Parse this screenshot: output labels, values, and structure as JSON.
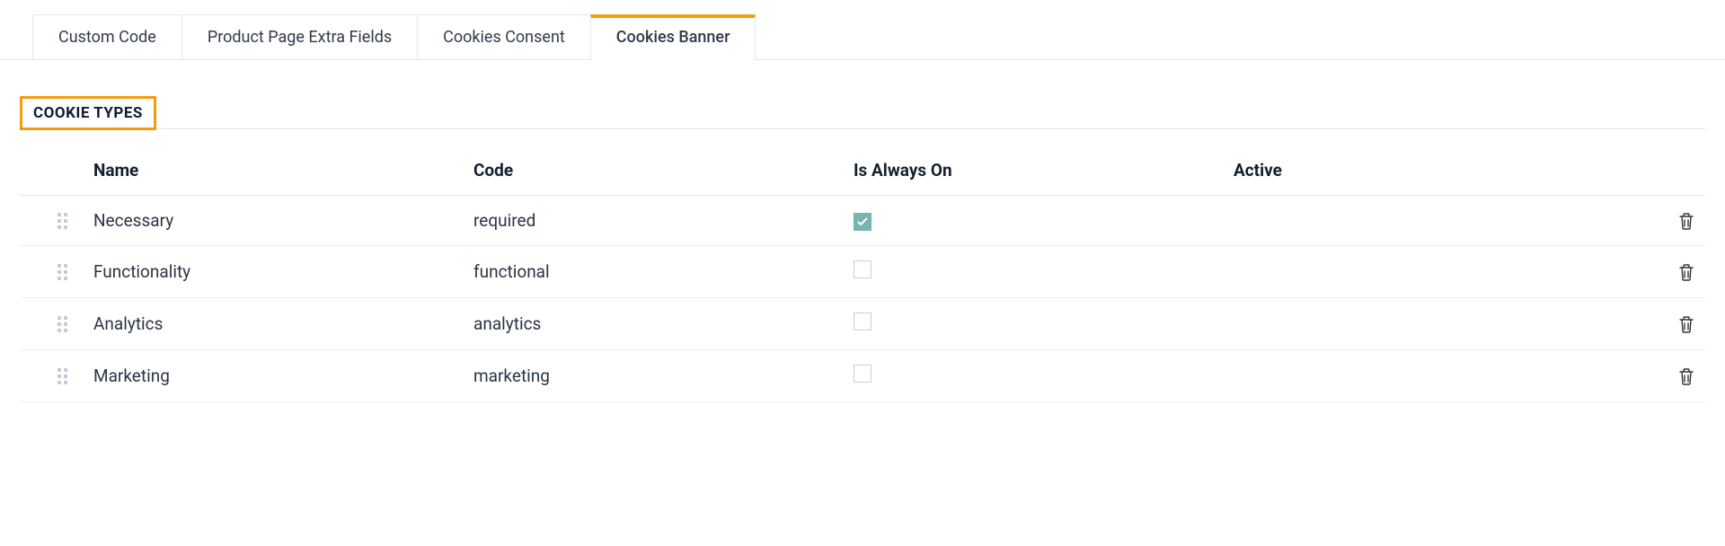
{
  "tabs": [
    {
      "label": "Custom Code",
      "active": false
    },
    {
      "label": "Product Page Extra Fields",
      "active": false
    },
    {
      "label": "Cookies Consent",
      "active": false
    },
    {
      "label": "Cookies Banner",
      "active": true
    }
  ],
  "section_title": "COOKIE TYPES",
  "columns": {
    "name": "Name",
    "code": "Code",
    "always_on": "Is Always On",
    "active": "Active"
  },
  "rows": [
    {
      "name": "Necessary",
      "code": "required",
      "always_on": true,
      "active": true
    },
    {
      "name": "Functionality",
      "code": "functional",
      "always_on": false,
      "active": true
    },
    {
      "name": "Analytics",
      "code": "analytics",
      "always_on": false,
      "active": true
    },
    {
      "name": "Marketing",
      "code": "marketing",
      "always_on": false,
      "active": true
    }
  ]
}
